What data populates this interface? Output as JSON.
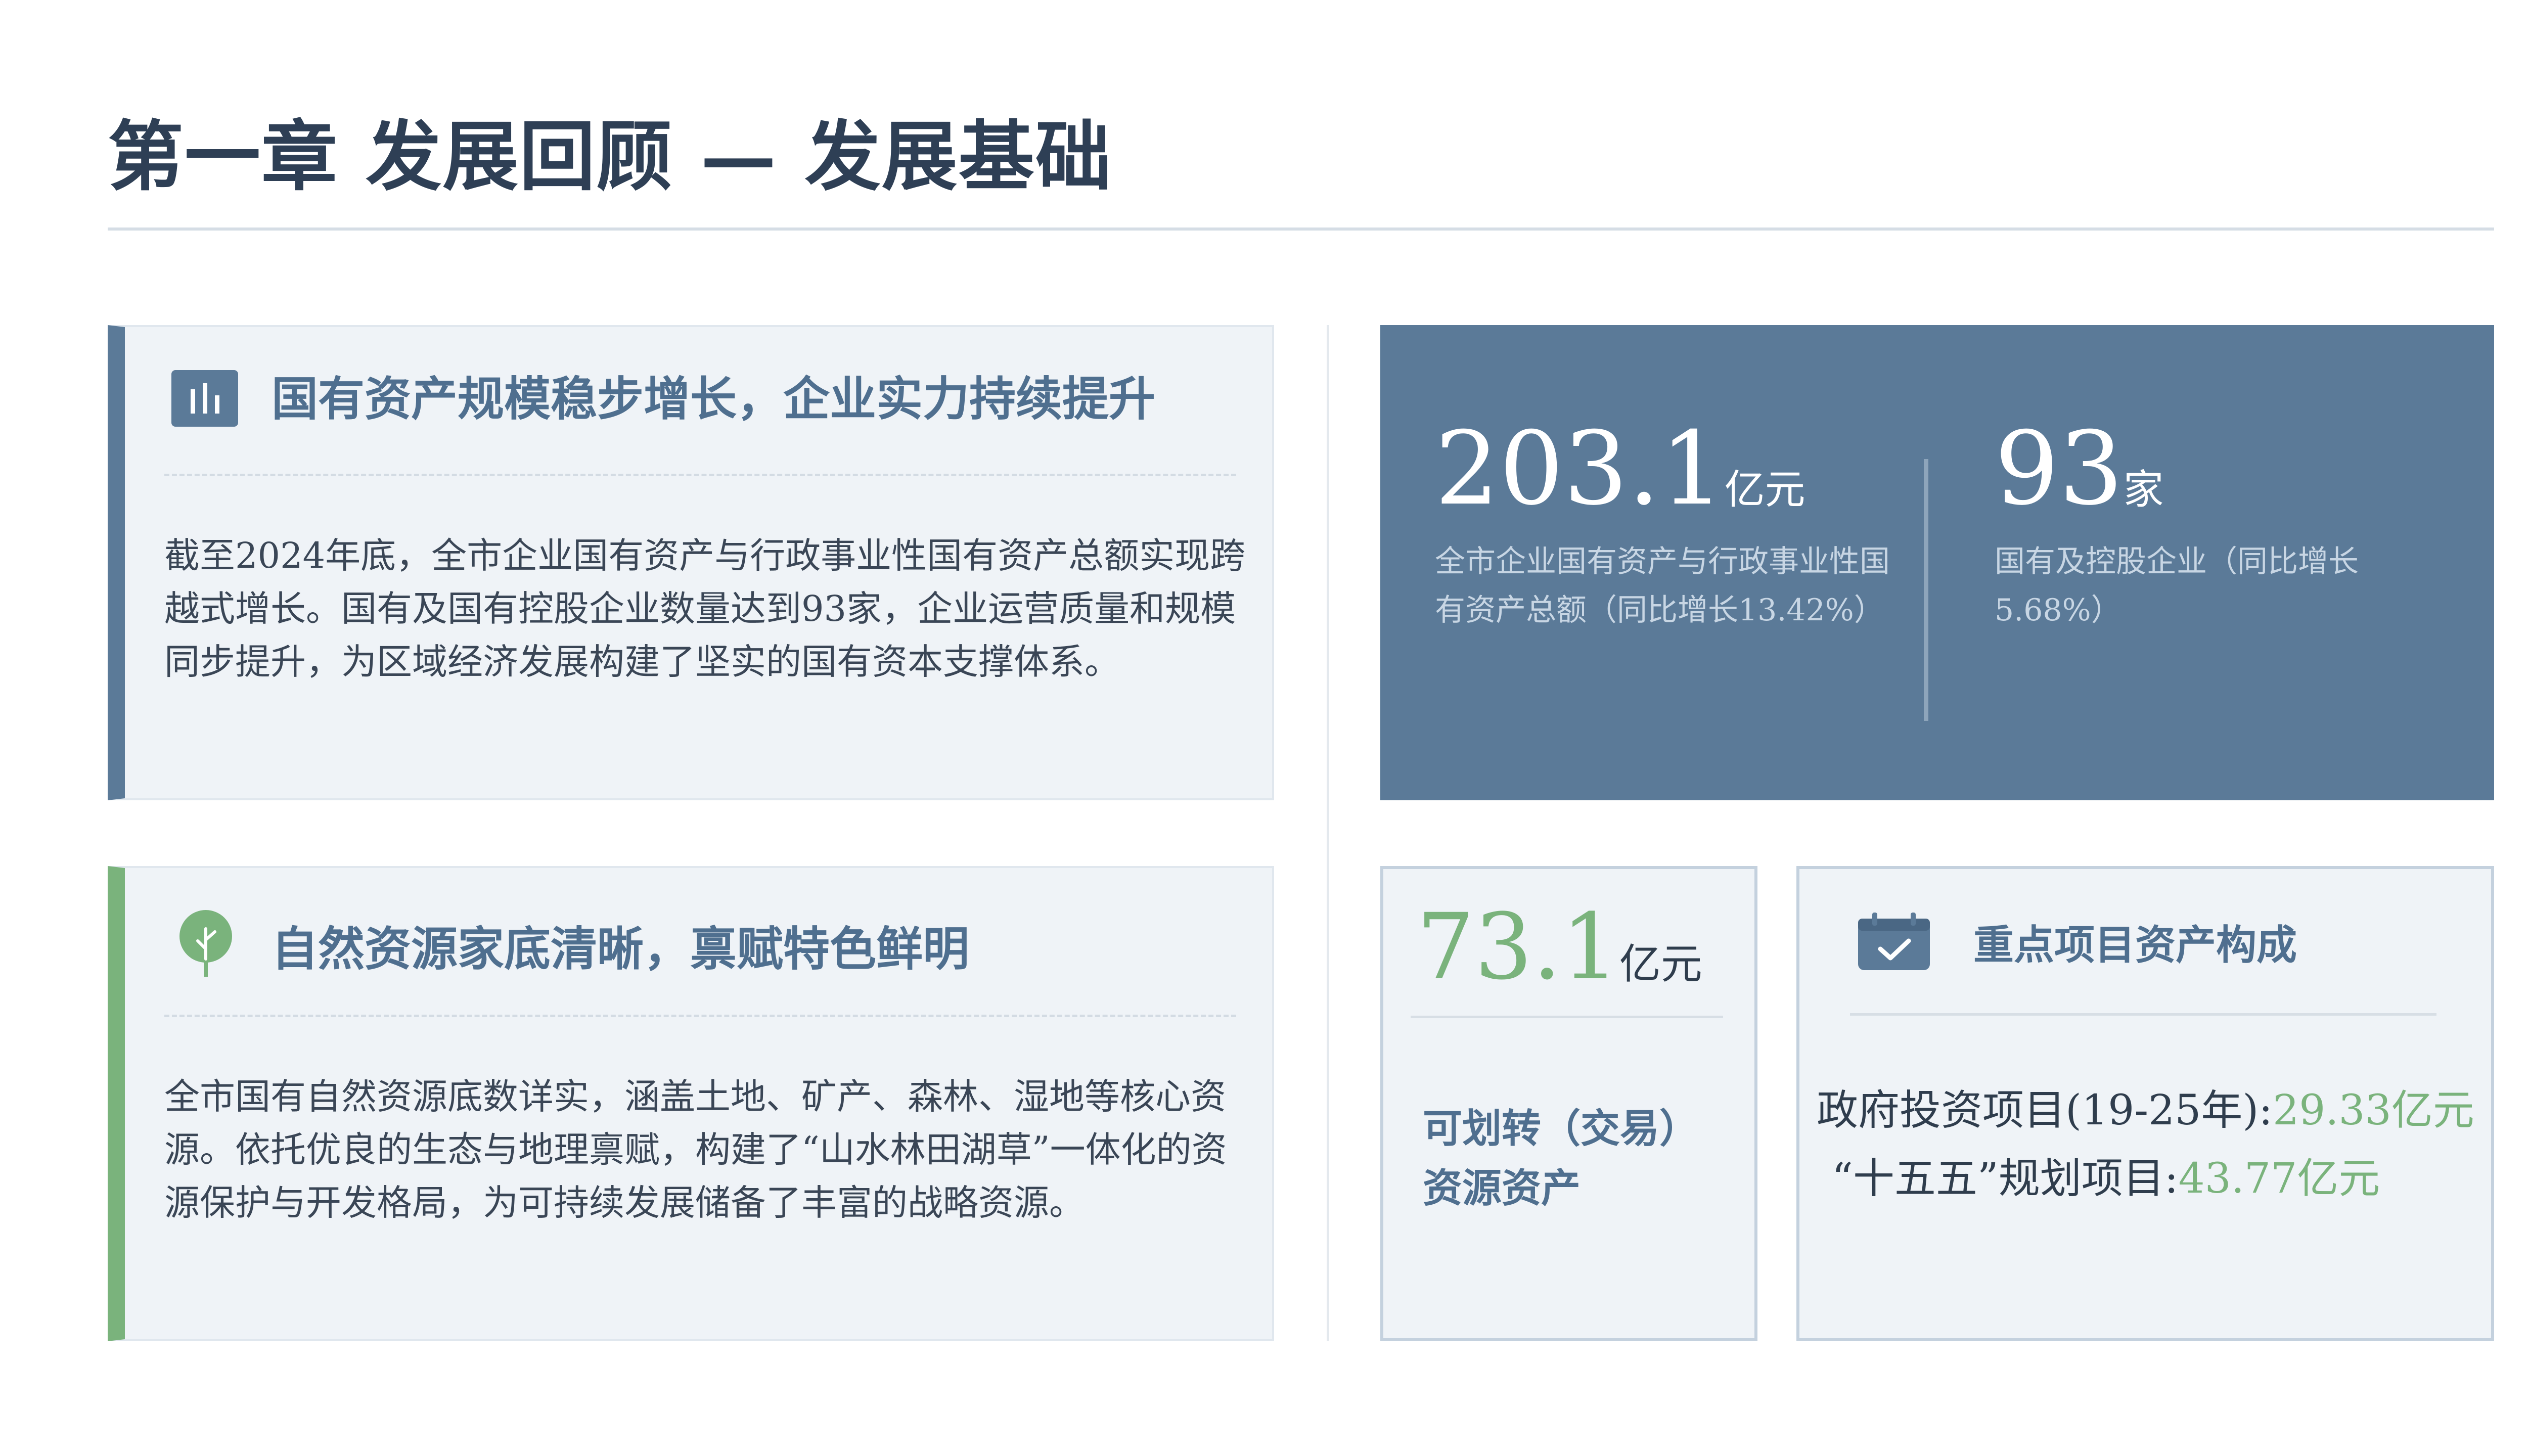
{
  "header": {
    "title": "第一章  发展回顾 — 发展基础"
  },
  "panels": [
    {
      "heading": "国有资产规模稳步增长，企业实力持续提升",
      "icon": "bar-chart-icon",
      "body": "截至2024年底，全市企业国有资产与行政事业性国有资产总额实现跨越式增长。国有及国有控股企业数量达到93家，企业运营质量和规模同步提升，为区域经济发展构建了坚实的国有资本支撑体系。"
    },
    {
      "heading": "自然资源家底清晰，禀赋特色鲜明",
      "icon": "leaf-icon",
      "body": "全市国有自然资源底数详实，涵盖土地、矿产、森林、湿地等核心资源。依托优良的生态与地理禀赋，构建了“山水林田湖草”一体化的资源保护与开发格局，为可持续发展储备了丰富的战略资源。"
    }
  ],
  "stats": {
    "assets_value": "203.1",
    "assets_unit": "亿元",
    "assets_desc": "全市企业国有资产与行政事业性国有资产总额（同比增长13.42%）",
    "firms_value": "93",
    "firms_unit": "家",
    "firms_desc": "国有及控股企业（同比增长5.68%）"
  },
  "transferable": {
    "value": "73.1",
    "unit": "亿元",
    "label": "可划转（交易）资源资产"
  },
  "projects": {
    "title": "重点项目资产构成",
    "icon": "calendar-check-icon",
    "gov_label": "政府投资项目(19-25年):",
    "gov_value": "29.33亿元",
    "plan_label": "“十五五”规划项目:",
    "plan_value": "43.77亿元"
  },
  "colors": {
    "primary": "#5b7a98",
    "green": "#7ab37c",
    "panel_bg": "#eff3f7",
    "title": "#2e3f55"
  }
}
